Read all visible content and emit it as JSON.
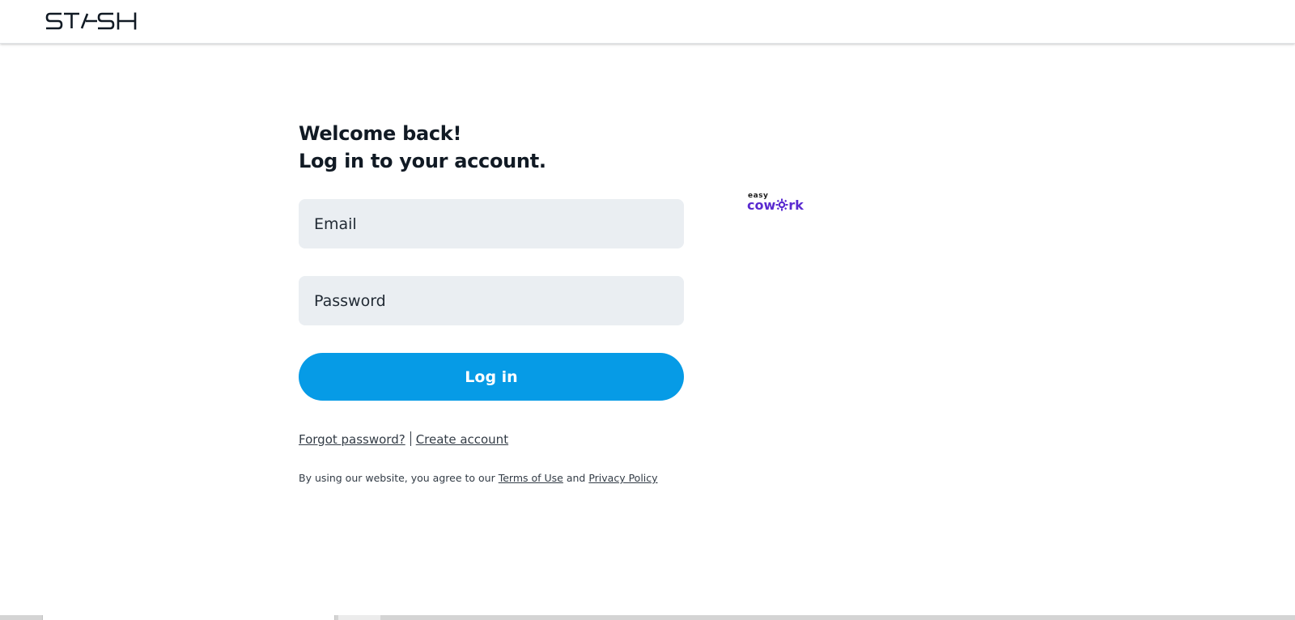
{
  "header": {
    "logo_text": "STASH"
  },
  "login": {
    "heading_line1": "Welcome back!",
    "heading_line2": "Log in to your account.",
    "email_placeholder": "Email",
    "password_placeholder": "Password",
    "login_label": "Log in",
    "forgot_password": "Forgot password?",
    "create_account": "Create account",
    "legal_prefix": "By using our website, you agree to our ",
    "terms_of_use": "Terms of Use",
    "legal_and": " and ",
    "privacy_policy": "Privacy Policy"
  },
  "badge": {
    "small_text": "easy",
    "big_text_part1": "cow",
    "big_text_part2": "rk",
    "icon": "gear-icon"
  },
  "colors": {
    "accent": "#069be6",
    "input_bg": "#eaeef2",
    "badge_purple": "#5a2ad0"
  }
}
